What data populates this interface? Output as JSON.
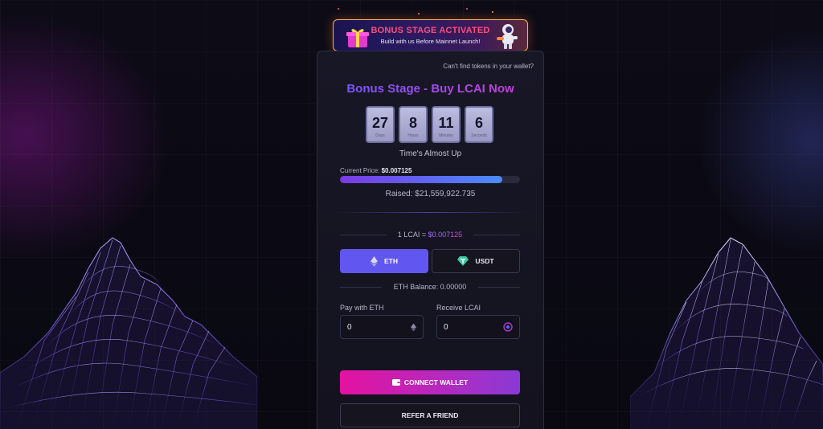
{
  "banner": {
    "title": "BONUS STAGE ACTIVATED",
    "subtitle": "Build with us Before Mainnet Launch!",
    "gift_icon": "gift-icon",
    "astronaut_icon": "astronaut-icon"
  },
  "card": {
    "cant_find": "Can't find tokens in your wallet?",
    "title": "Bonus Stage - Buy LCAI Now"
  },
  "countdown": [
    {
      "value": "27",
      "label": "Days"
    },
    {
      "value": "8",
      "label": "Hours"
    },
    {
      "value": "11",
      "label": "Minutes"
    },
    {
      "value": "6",
      "label": "Seconds"
    }
  ],
  "status": {
    "almost_up": "Time's Almost Up",
    "current_price_label": "Current Price:",
    "current_price_value": "$0.007125",
    "progress_percent": 90,
    "raised": "Raised: $21,559,922.735"
  },
  "rate": {
    "left": "1 LCAI = ",
    "price_a": "$0.007",
    "price_b": "125"
  },
  "tokens": {
    "eth_label": "ETH",
    "usdt_label": "USDT",
    "eth_icon": "eth-icon",
    "usdt_icon": "usdt-icon"
  },
  "balance": "ETH Balance: 0.00000",
  "inputs": {
    "pay_label": "Pay with ETH",
    "pay_value": "0",
    "receive_label": "Receive LCAI",
    "receive_value": "0"
  },
  "actions": {
    "connect_label": "CONNECT WALLET",
    "refer_label": "REFER A FRIEND"
  },
  "colors": {
    "accent_purple": "#6256f0",
    "accent_pink": "#e312a0",
    "banner_title": "#ff4d7a"
  }
}
